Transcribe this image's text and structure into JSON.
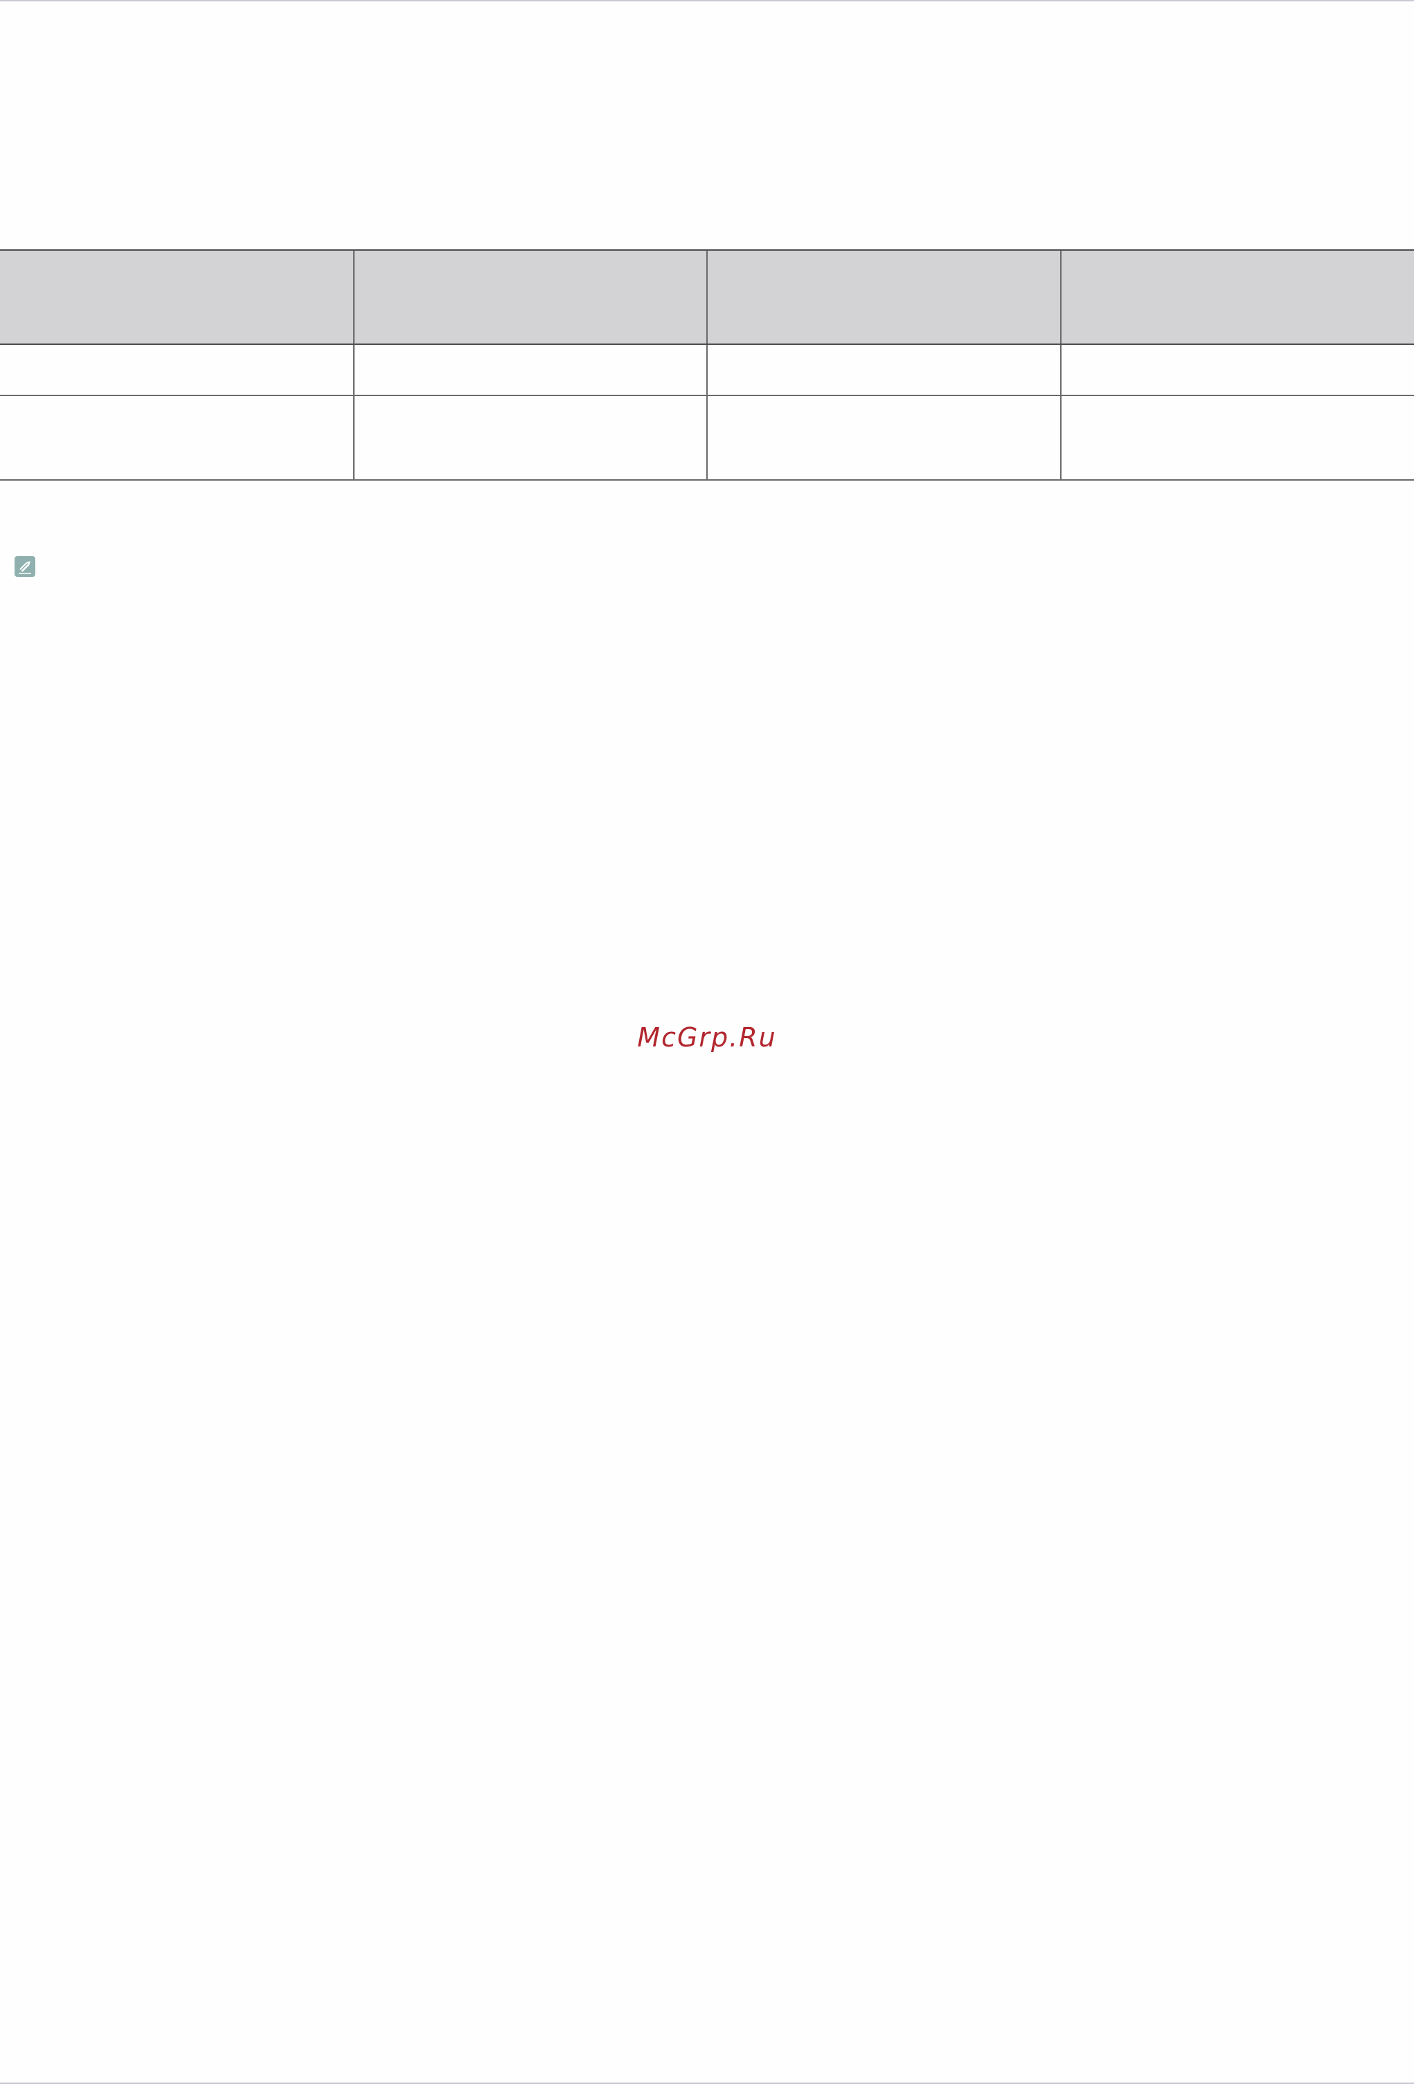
{
  "watermark": {
    "text": "McGrp.Ru"
  },
  "note": {
    "icon": "pencil-note-icon",
    "icon_color": "#8fb0ae"
  },
  "table": {
    "header_fill": "#d3d3d5",
    "columns": [
      "",
      "",
      "",
      ""
    ],
    "rows": [
      [
        "",
        "",
        "",
        ""
      ],
      [
        "",
        "",
        "",
        ""
      ]
    ]
  }
}
